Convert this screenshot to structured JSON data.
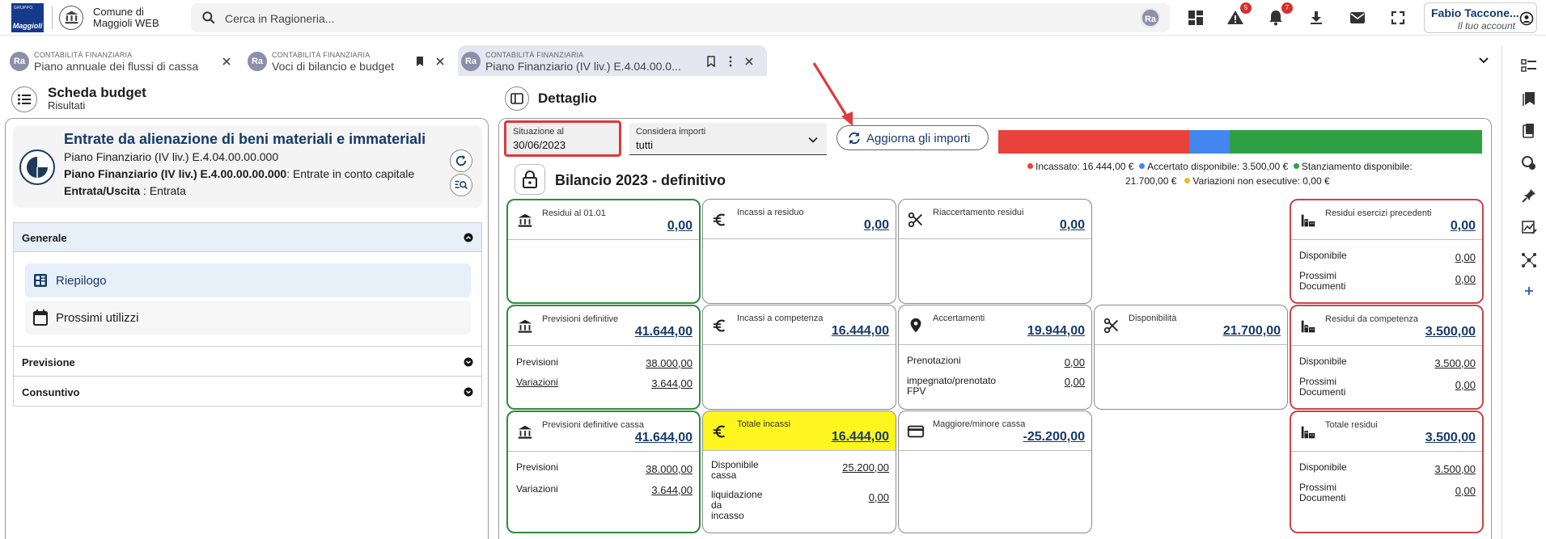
{
  "header": {
    "logo_small": "GRUPPO",
    "logo_big": "Maggioli",
    "org_name_line1": "Comune di",
    "org_name_line2": "Maggioli WEB",
    "search_placeholder": "Cerca in Ragioneria...",
    "ra_badge": "Ra",
    "alerts_count": "5",
    "notifications_count": "7",
    "user_name": "Fabio Taccone...",
    "user_sub": "Il tuo account"
  },
  "tabs": [
    {
      "category": "CONTABILITÀ FINANZIARIA",
      "title": "Piano annuale dei flussi di cassa"
    },
    {
      "category": "CONTABILITÀ FINANZIARIA",
      "title": "Voci di bilancio e budget"
    },
    {
      "category": "CONTABILITÀ FINANZIARIA",
      "title": "Piano Finanziario (IV liv.) E.4.04.00.0..."
    }
  ],
  "left": {
    "title": "Scheda budget",
    "subtitle": "Risultati",
    "entity_title": "Entrate da alienazione di beni materiali e immateriali",
    "entity_line1": "Piano Finanziario (IV liv.) E.4.04.00.00.000",
    "entity_line2_bold": "Piano Finanziario (IV liv.) E.4.00.00.00.000",
    "entity_line2_rest": ": Entrate in conto capitale",
    "entity_line3_bold": "Entrata/Uscita",
    "entity_line3_rest": " : Entrata",
    "sections": {
      "generale": "Generale",
      "riepilogo": "Riepilogo",
      "prossimi": "Prossimi utilizzi",
      "previsione": "Previsione",
      "consuntivo": "Consuntivo"
    }
  },
  "right": {
    "title": "Dettaglio",
    "situazione_label": "Situazione al",
    "situazione_value": "30/06/2023",
    "considera_label": "Considera importi",
    "considera_value": "tutti",
    "refresh_label": "Aggiorna gli importi",
    "bilancio_title": "Bilancio 2023 - definitivo",
    "legend": {
      "incassato": "Incassato: 16.444,00 €",
      "accertato": "Accertato disponibile: 3.500,00 €",
      "stanziamento": "Stanziamento disponibile:",
      "stanziamento_value": "21.700,00 €",
      "variazioni": "Variazioni non esecutive: 0,00 €"
    },
    "bar": {
      "incassato": 16444,
      "accertato": 3500,
      "stanziamento": 21700,
      "colors": {
        "incassato": "#e8423a",
        "accertato": "#4286f0",
        "stanziamento": "#2ea043",
        "variazioni": "#f2b824"
      }
    }
  },
  "cards": {
    "residui_0101": {
      "title": "Residui al 01.01",
      "amount": "0,00"
    },
    "incassi_residuo": {
      "title": "Incassi a residuo",
      "amount": "0,00"
    },
    "riaccertamento": {
      "title": "Riaccertamento residui",
      "amount": "0,00"
    },
    "residui_prec": {
      "title": "Residui esercizi precedenti",
      "amount": "0,00",
      "r1_label": "Disponibile",
      "r1_value": "0,00",
      "r2_label1": "Prossimi",
      "r2_label2": "Documenti",
      "r2_value": "0,00"
    },
    "prev_def": {
      "title": "Previsioni definitive",
      "amount": "41.644,00",
      "r1_label": "Previsioni",
      "r1_value": "38.000,00",
      "r2_label": "Variazioni",
      "r2_value": "3.644,00"
    },
    "incassi_comp": {
      "title": "Incassi a competenza",
      "amount": "16.444,00"
    },
    "accertamenti": {
      "title": "Accertamenti",
      "amount": "19.944,00",
      "r1_label": "Prenotazioni",
      "r1_value": "0,00",
      "r2_label1": "impegnato/prenotato",
      "r2_label2": "FPV",
      "r2_value": "0,00"
    },
    "disponibilita": {
      "title": "Disponibilità",
      "amount": "21.700,00"
    },
    "residui_comp": {
      "title": "Residui da competenza",
      "amount": "3.500,00",
      "r1_label": "Disponibile",
      "r1_value": "3.500,00",
      "r2_label1": "Prossimi",
      "r2_label2": "Documenti",
      "r2_value": "0,00"
    },
    "prev_cassa": {
      "title": "Previsioni definitive cassa",
      "amount": "41.644,00",
      "r1_label": "Previsioni",
      "r1_value": "38.000,00",
      "r2_label": "Variazioni",
      "r2_value": "3.644,00"
    },
    "totale_incassi": {
      "title": "Totale incassi",
      "amount": "16.444,00",
      "r1_label1": "Disponibile",
      "r1_label2": "cassa",
      "r1_value": "25.200,00",
      "r2_label1": "liquidazione",
      "r2_label2": "da",
      "r2_label3": "incasso",
      "r2_value": "0,00"
    },
    "maggiore": {
      "title": "Maggiore/minore cassa",
      "amount": "-25.200,00"
    },
    "totale_residui": {
      "title": "Totale residui",
      "amount": "3.500,00",
      "r1_label": "Disponibile",
      "r1_value": "3.500,00",
      "r2_label1": "Prossimi",
      "r2_label2": "Documenti",
      "r2_value": "0,00"
    }
  }
}
